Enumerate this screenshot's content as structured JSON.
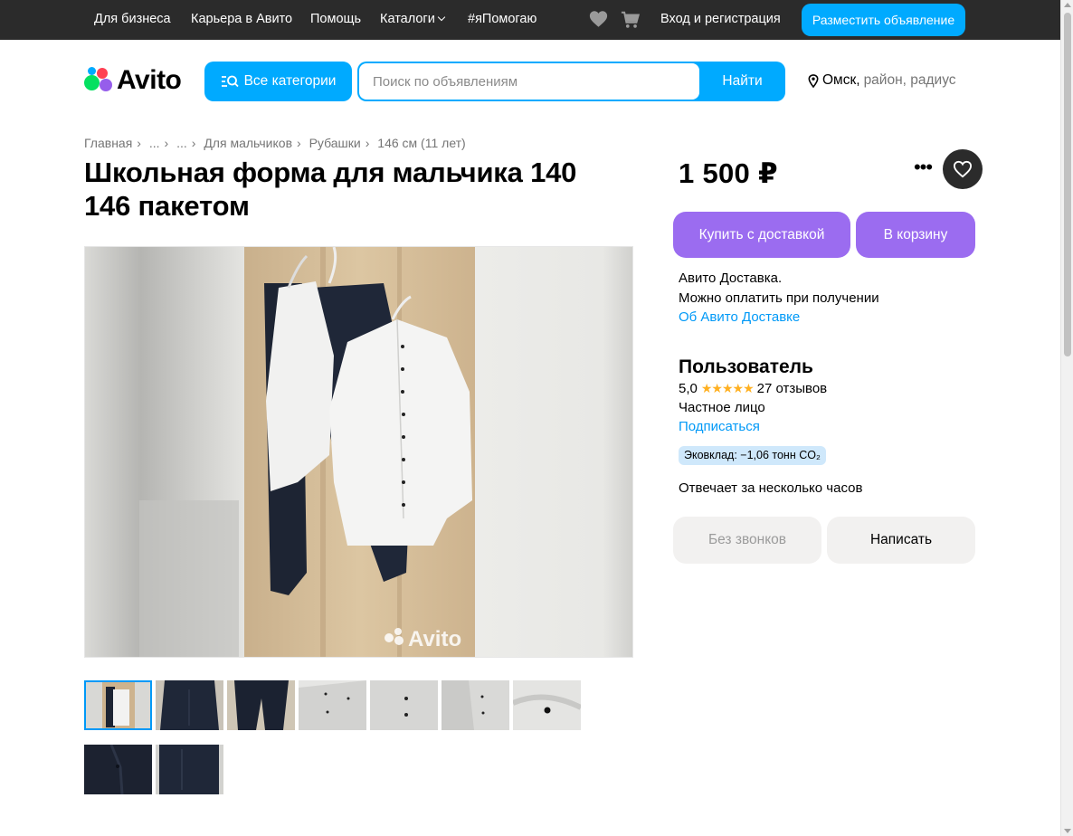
{
  "topbar": {
    "links": [
      "Для бизнеса",
      "Карьера в Авито",
      "Помощь",
      "Каталоги",
      "#яПомогаю"
    ],
    "login": "Вход и регистрация",
    "post_ad": "Разместить объявление"
  },
  "header": {
    "logo_text": "Avito",
    "categories_button": "Все категории",
    "search_placeholder": "Поиск по объявлениям",
    "search_button": "Найти",
    "location_city": "Омск,",
    "location_extra": "район, радиус"
  },
  "breadcrumbs": [
    "Главная",
    "...",
    "...",
    "Для мальчиков",
    "Рубашки",
    "146 см (11 лет)"
  ],
  "listing": {
    "title": "Школьная форма для мальчика 140 146 пакетом",
    "price": "1 500 ₽",
    "watermark": "Avito",
    "buy_delivery": "Купить с доставкой",
    "to_cart": "В корзину",
    "delivery_line1": "Авито Доставка.",
    "delivery_line2": "Можно оплатить при получении",
    "delivery_link": "Об Авито Доставке"
  },
  "seller": {
    "name": "Пользователь",
    "rating": "5,0",
    "stars": "★★★★★",
    "reviews": "27 отзывов",
    "type": "Частное лицо",
    "subscribe": "Подписаться",
    "eco": "Эковклад: −1,06 тонн CO₂",
    "reply_time": "Отвечает за несколько часов",
    "no_calls": "Без звонков",
    "write": "Написать"
  },
  "colors": {
    "accent_blue": "#00aaff",
    "purple": "#9b6cf0",
    "topbar": "#2b2b2b",
    "link": "#0099f7"
  },
  "icons": [
    "heart-icon",
    "cart-icon",
    "chevron-down-icon",
    "search-icon",
    "location-pin-icon",
    "more-icon",
    "favorite-heart-icon",
    "star-icon"
  ]
}
